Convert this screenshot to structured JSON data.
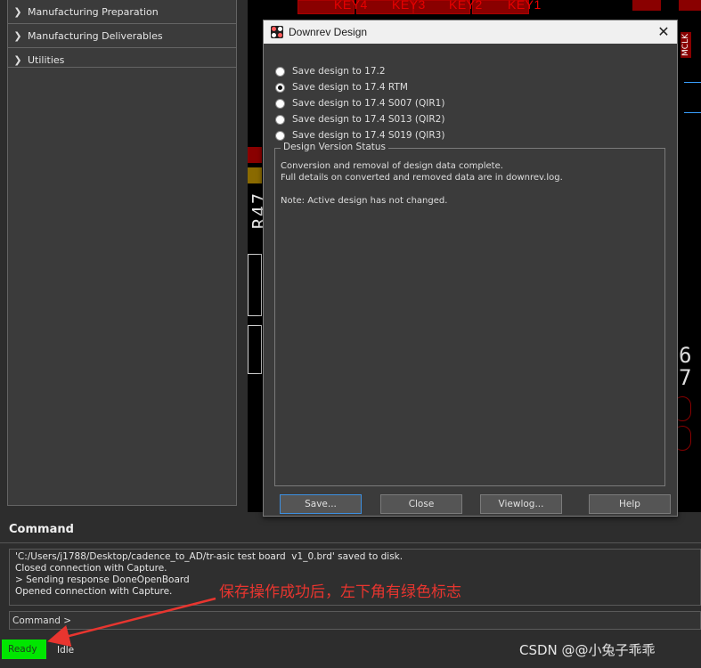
{
  "left_panel": {
    "items": [
      {
        "label": "Manufacturing Preparation"
      },
      {
        "label": "Manufacturing Deliverables"
      },
      {
        "label": "Utilities"
      }
    ]
  },
  "pcb": {
    "keys": [
      "KEY4",
      "KEY3",
      "KEY2",
      "KEY1"
    ],
    "vertical_text": "R47",
    "right_label": "MCLK",
    "right_digits": [
      "6",
      "7"
    ]
  },
  "dialog": {
    "title": "Downrev Design",
    "options": [
      {
        "label": "Save design to 17.2",
        "selected": false
      },
      {
        "label": "Save design to 17.4 RTM",
        "selected": true
      },
      {
        "label": "Save design to 17.4 S007 (QIR1)",
        "selected": false
      },
      {
        "label": "Save design to 17.4 S013 (QIR2)",
        "selected": false
      },
      {
        "label": "Save design to 17.4 S019 (QIR3)",
        "selected": false
      }
    ],
    "status_group": {
      "legend": "Design Version Status",
      "message": "Conversion and removal of design data complete.\nFull details on converted and removed data are in downrev.log.\n\nNote: Active design has not changed."
    },
    "buttons": {
      "save": "Save...",
      "close": "Close",
      "viewlog": "Viewlog...",
      "help": "Help"
    }
  },
  "command": {
    "title": "Command",
    "log": "'C:/Users/j1788/Desktop/cadence_to_AD/tr-asic test board  v1_0.brd' saved to disk.\nClosed connection with Capture.\n> Sending response DoneOpenBoard\nOpened connection with Capture.",
    "prompt": "Command >"
  },
  "status_bar": {
    "ready": "Ready",
    "idle": "Idle"
  },
  "annotation": "保存操作成功后，左下角有绿色标志",
  "watermark": "CSDN @@小兔子乖乖",
  "colors": {
    "ready_green": "#00e600",
    "annotation_red": "#e8352f",
    "pcb_red": "#e80000"
  }
}
